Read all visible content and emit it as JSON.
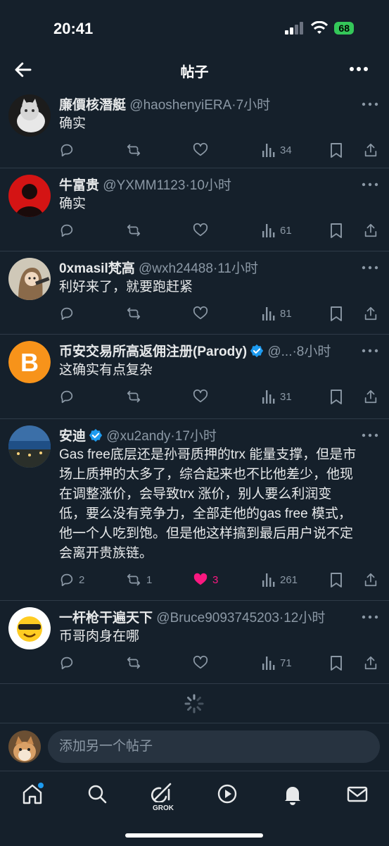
{
  "status_bar": {
    "time": "20:41",
    "battery": "68"
  },
  "header": {
    "title": "帖子"
  },
  "posts": [
    {
      "name": "廉價核潛艇",
      "handle": "@haoshenyiERA",
      "time": "·7小时",
      "text": "确实",
      "replies": "",
      "reposts": "",
      "likes": "",
      "views": "34"
    },
    {
      "name": "牛富贵",
      "handle": "@YXMM1123",
      "time": "·10小时",
      "text": "确实",
      "replies": "",
      "reposts": "",
      "likes": "",
      "views": "61"
    },
    {
      "name": "0xmasil梵高",
      "handle": "@wxh24488",
      "time": "·11小时",
      "text": "利好来了，就要跑赶紧",
      "replies": "",
      "reposts": "",
      "likes": "",
      "views": "81"
    },
    {
      "name": "币安交易所高返佣注册(Parody)",
      "handle": "@...",
      "time": "·8小时",
      "text": "这确实有点复杂",
      "replies": "",
      "reposts": "",
      "likes": "",
      "views": "31",
      "verified": true
    },
    {
      "name": "安迪",
      "handle": "@xu2andy",
      "time": "·17小时",
      "text_lines": [
        "Gas free底层还是孙哥质押的trx 能量支撑，但是市",
        "场上质押的太多了，综合起来也不比他差少，他现",
        "在调整涨价，会导致trx 涨价，别人要么利润变",
        "低，要么没有竞争力，全部走他的gas free 模式，",
        "他一个人吃到饱。但是他这样搞到最后用户说不定",
        "会离开贵族链。"
      ],
      "replies": "2",
      "reposts": "1",
      "likes": "3",
      "views": "261",
      "verified": true,
      "liked": true
    },
    {
      "name": "一杆枪干遍天下",
      "handle": "@Bruce9093745203",
      "time": "·12小时",
      "text": "币哥肉身在哪",
      "replies": "",
      "reposts": "",
      "likes": "",
      "views": "71"
    }
  ],
  "composer": {
    "placeholder": "添加另一个帖子"
  },
  "tabbar": {
    "grok_label": "GROK"
  },
  "colors": {
    "background": "#15202b",
    "accent": "#1d9bf0",
    "like": "#f91880",
    "muted": "#8b98a5"
  }
}
